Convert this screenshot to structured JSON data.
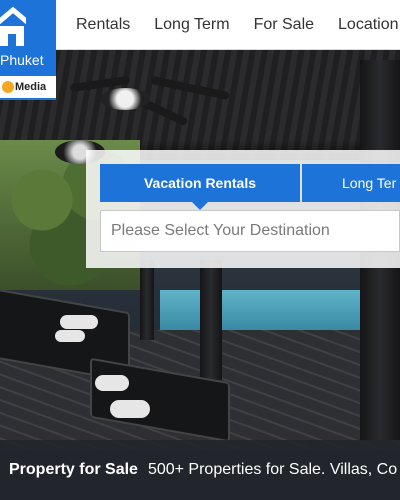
{
  "header": {
    "brand": "Phuket",
    "media_logo": "Media",
    "nav": [
      {
        "label": "Rentals"
      },
      {
        "label": "Long Term"
      },
      {
        "label": "For Sale"
      },
      {
        "label": "Location G"
      }
    ]
  },
  "search": {
    "tabs": [
      {
        "label": "Vacation Rentals",
        "active": true
      },
      {
        "label": "Long Ter",
        "active": false
      }
    ],
    "destination_placeholder": "Please Select Your Destination"
  },
  "banner": {
    "title": "Property for Sale",
    "description": "500+ Properties for Sale. Villas, Co"
  },
  "icons": {
    "logo_icon": "house-icon",
    "media_dot": "circle-dot-icon"
  },
  "colors": {
    "brand_blue": "#1e73d8",
    "nav_text": "#333333",
    "banner_bg": "#23262c"
  }
}
